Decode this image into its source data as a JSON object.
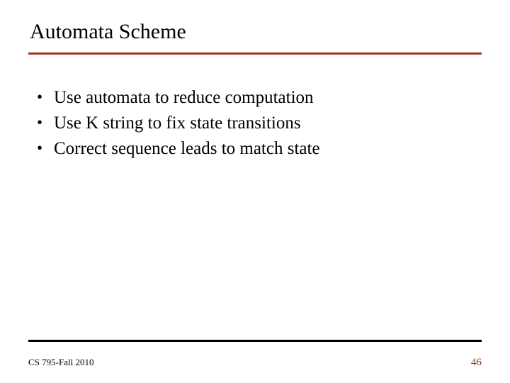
{
  "title": "Automata Scheme",
  "bullets": [
    "Use automata to reduce computation",
    "Use K string to fix state transitions",
    "Correct sequence leads to match state"
  ],
  "footer": {
    "left": "CS 795-Fall 2010",
    "page": "46"
  }
}
